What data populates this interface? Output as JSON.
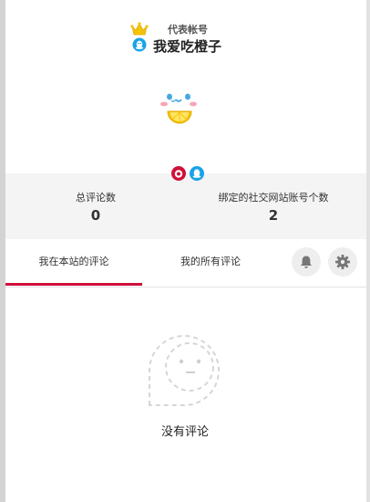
{
  "header": {
    "rep_label": "代表帐号",
    "username": "我爱吃橙子"
  },
  "stats": {
    "total_comments_label": "总评论数",
    "total_comments_value": "0",
    "bound_accounts_label": "绑定的社交网站账号个数",
    "bound_accounts_value": "2"
  },
  "tabs": {
    "site_comments": "我在本站的评论",
    "all_comments": "我的所有评论",
    "active": "site_comments"
  },
  "empty": {
    "text": "没有评论"
  },
  "colors": {
    "accent": "#d0103a",
    "qq_blue": "#1aa3e8",
    "weibo_red": "#d0103a",
    "crown": "#f5c400"
  },
  "icons": [
    "crown-icon",
    "qq-icon",
    "weibo-icon",
    "bell-icon",
    "gear-icon",
    "empty-comment-icon"
  ]
}
